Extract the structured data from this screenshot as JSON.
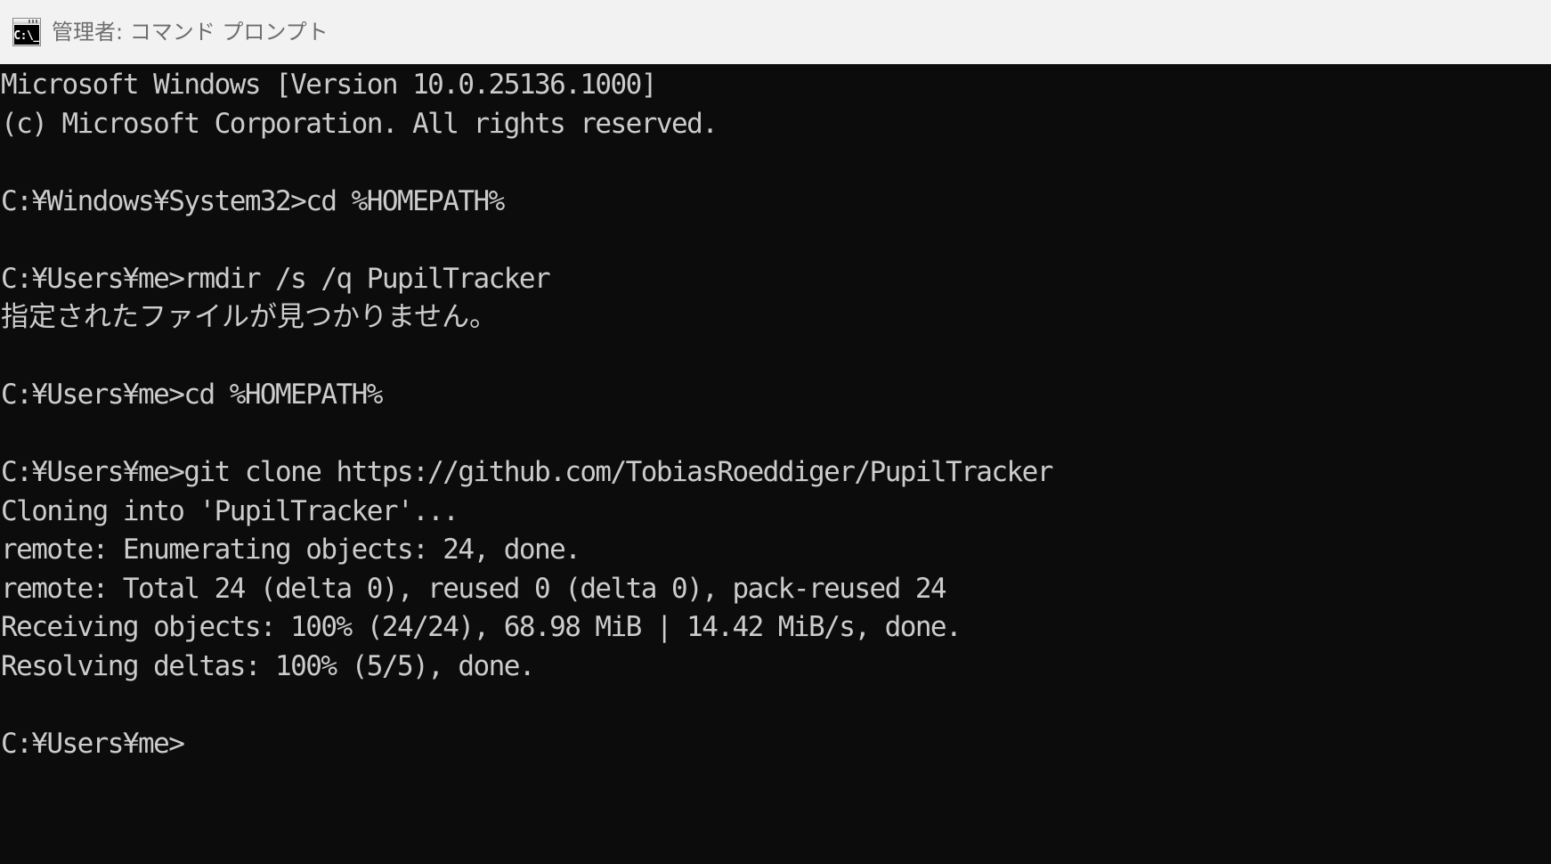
{
  "window": {
    "title": "管理者: コマンド プロンプト",
    "icon": "cmd-prompt-icon",
    "icon_glyph": "C:\\_",
    "titlebar_bg": "#f2f2f2",
    "titlebar_text_color": "#6e6e6e",
    "terminal_bg": "#0c0c0c",
    "terminal_fg": "#cccccc"
  },
  "terminal": {
    "lines": [
      {
        "text": "Microsoft Windows [Version 10.0.25136.1000]",
        "kind": "output"
      },
      {
        "text": "(c) Microsoft Corporation. All rights reserved.",
        "kind": "output"
      },
      {
        "text": "",
        "kind": "blank"
      },
      {
        "text": "C:¥Windows¥System32>cd %HOMEPATH%",
        "kind": "prompt"
      },
      {
        "text": "",
        "kind": "blank"
      },
      {
        "text": "C:¥Users¥me>rmdir /s /q PupilTracker",
        "kind": "prompt"
      },
      {
        "text": "指定されたファイルが見つかりません。",
        "kind": "output-jp"
      },
      {
        "text": "",
        "kind": "blank"
      },
      {
        "text": "C:¥Users¥me>cd %HOMEPATH%",
        "kind": "prompt"
      },
      {
        "text": "",
        "kind": "blank"
      },
      {
        "text": "C:¥Users¥me>git clone https://github.com/TobiasRoeddiger/PupilTracker",
        "kind": "prompt"
      },
      {
        "text": "Cloning into 'PupilTracker'...",
        "kind": "output"
      },
      {
        "text": "remote: Enumerating objects: 24, done.",
        "kind": "output"
      },
      {
        "text": "remote: Total 24 (delta 0), reused 0 (delta 0), pack-reused 24",
        "kind": "output"
      },
      {
        "text": "Receiving objects: 100% (24/24), 68.98 MiB | 14.42 MiB/s, done.",
        "kind": "output"
      },
      {
        "text": "Resolving deltas: 100% (5/5), done.",
        "kind": "output"
      },
      {
        "text": "",
        "kind": "blank"
      },
      {
        "text": "C:¥Users¥me>",
        "kind": "prompt"
      }
    ]
  }
}
